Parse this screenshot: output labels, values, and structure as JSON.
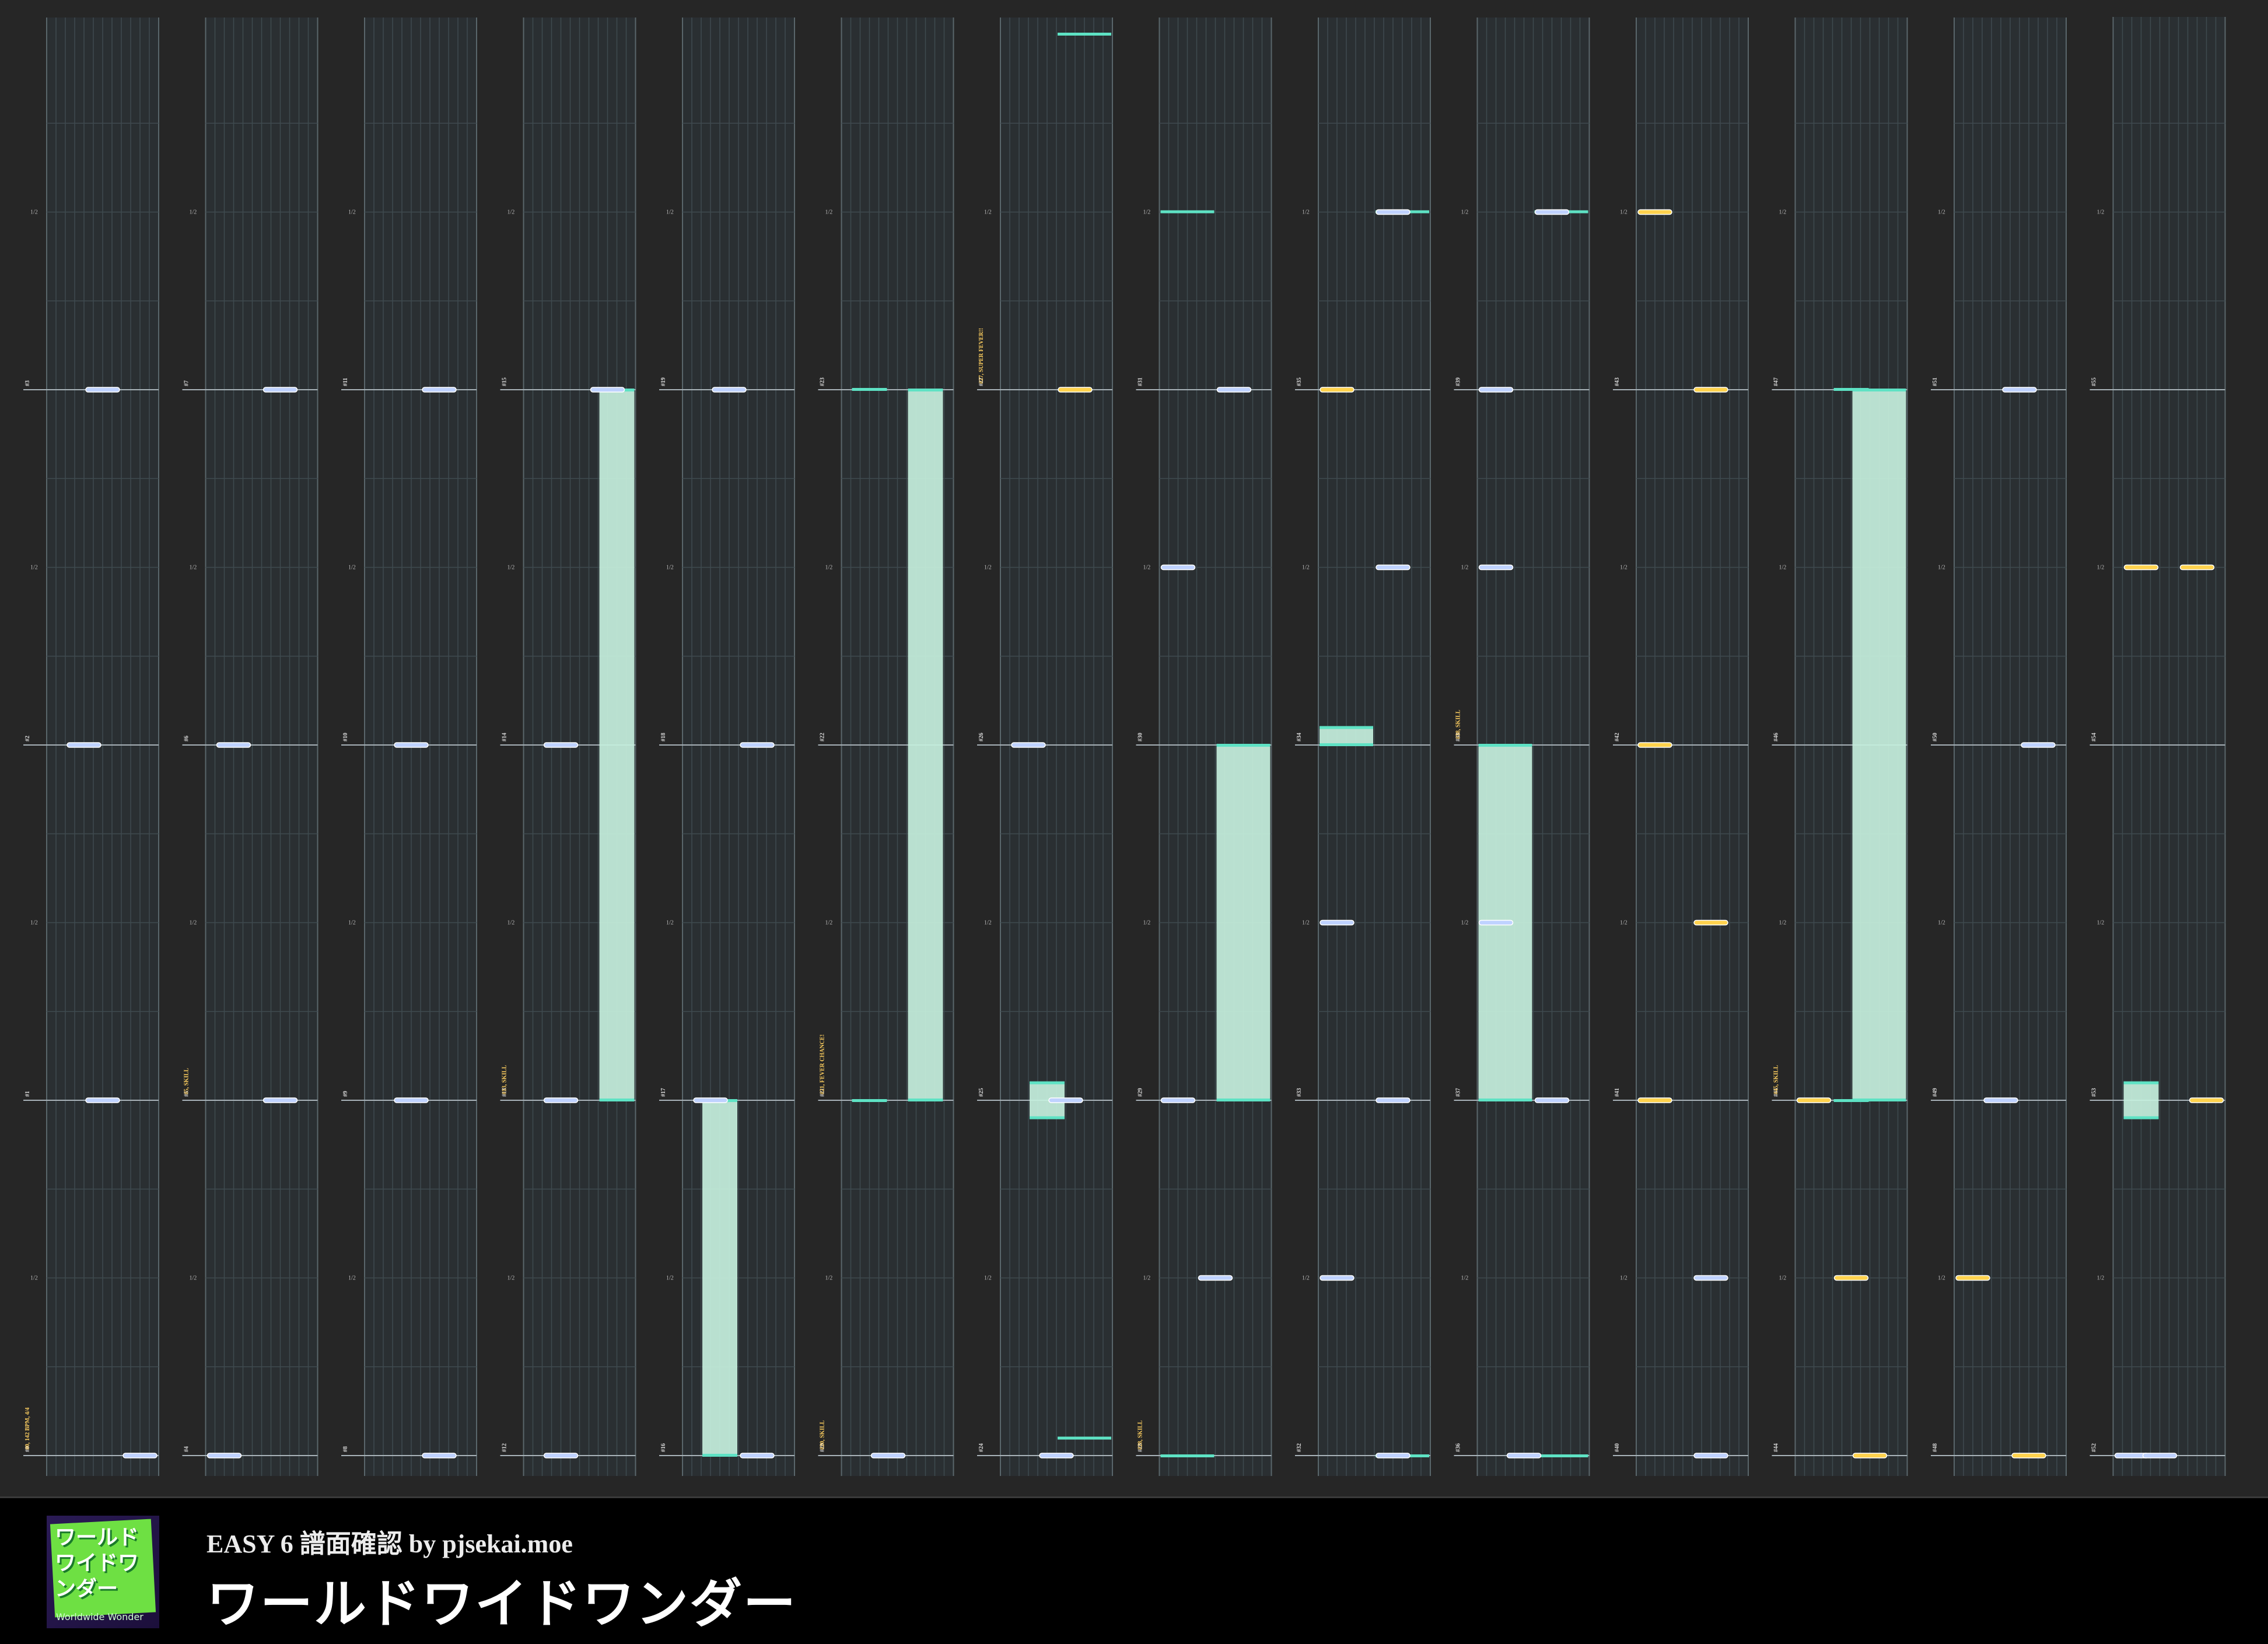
{
  "chart_data": {
    "type": "rhythm_game_chart",
    "difficulty": "EASY",
    "level": 6,
    "lanes": 12,
    "bars_per_column": 4,
    "total_bars": 56,
    "events": [
      {
        "bar": 0,
        "text": "#0, 142 BPM, 4/4"
      },
      {
        "bar": 5,
        "text": "#5, SKILL"
      },
      {
        "bar": 13,
        "text": "#13, SKILL"
      },
      {
        "bar": 20,
        "text": "#20, SKILL"
      },
      {
        "bar": 21,
        "text": "#21, FEVER CHANCE!"
      },
      {
        "bar": 27,
        "text": "#27, SUPER FEVER!!"
      },
      {
        "bar": 28,
        "text": "#28, SKILL"
      },
      {
        "bar": 38,
        "text": "#38, SKILL"
      },
      {
        "bar": 45,
        "text": "#45, SKILL"
      }
    ],
    "colors": {
      "tap": "#bfd2ff",
      "flick": "#ffd24d",
      "hold": "#c6f0dd",
      "hold_edge": "#5ee2c4"
    },
    "taps": [
      [
        0,
        0.0,
        8,
        12
      ],
      [
        1,
        0.0,
        4,
        8
      ],
      [
        2,
        0.0,
        2,
        6
      ],
      [
        3,
        0.0,
        4,
        8
      ],
      [
        4,
        0.0,
        0,
        4
      ],
      [
        5,
        0.0,
        6,
        10
      ],
      [
        6,
        0.0,
        1,
        5
      ],
      [
        7,
        0.0,
        6,
        10
      ],
      [
        8,
        0.0,
        6,
        10
      ],
      [
        9,
        0.0,
        3,
        7
      ],
      [
        10,
        0.0,
        3,
        7
      ],
      [
        11,
        0.0,
        6,
        10
      ],
      [
        12,
        0.0,
        2,
        6
      ],
      [
        13,
        0.0,
        2,
        6
      ],
      [
        14,
        0.0,
        2,
        6
      ],
      [
        15,
        0.0,
        7,
        11
      ],
      [
        16,
        0.0,
        6,
        10
      ],
      [
        17,
        0.0,
        1,
        5
      ],
      [
        18,
        0.0,
        6,
        10
      ],
      [
        19,
        0.0,
        3,
        7
      ],
      [
        20,
        0.0,
        3,
        7
      ],
      [
        24,
        0.0,
        4,
        8
      ],
      [
        25,
        0.0,
        5,
        9
      ],
      [
        26,
        0.0,
        1,
        5
      ],
      [
        28,
        0.5,
        4,
        8
      ],
      [
        29,
        0.0,
        0,
        4
      ],
      [
        30,
        0.5,
        0,
        4
      ],
      [
        31,
        0.0,
        6,
        10
      ],
      [
        32,
        0.0,
        6,
        10
      ],
      [
        32,
        0.5,
        0,
        4
      ],
      [
        33,
        0.0,
        6,
        10
      ],
      [
        33,
        0.5,
        0,
        4
      ],
      [
        34,
        0.5,
        6,
        10
      ],
      [
        35,
        0.5,
        6,
        10
      ],
      [
        36,
        0.0,
        3,
        7
      ],
      [
        37,
        0.0,
        6,
        10
      ],
      [
        37,
        0.5,
        0,
        4
      ],
      [
        38,
        0.5,
        0,
        4
      ],
      [
        39,
        0.0,
        0,
        4
      ],
      [
        39,
        0.5,
        6,
        10
      ],
      [
        40,
        0.0,
        6,
        10
      ],
      [
        40,
        0.5,
        6,
        10
      ],
      [
        49,
        0.0,
        3,
        7
      ],
      [
        50,
        0.0,
        7,
        11
      ],
      [
        51,
        0.0,
        5,
        9
      ],
      [
        52,
        0.0,
        0,
        4
      ],
      [
        52,
        0.0,
        3,
        7
      ]
    ],
    "flicks": [
      [
        27,
        0.0,
        6,
        10
      ],
      [
        35,
        0.0,
        0,
        4
      ],
      [
        41,
        0.0,
        0,
        4
      ],
      [
        41,
        0.5,
        6,
        10
      ],
      [
        42,
        0.0,
        0,
        4
      ],
      [
        43,
        0.0,
        6,
        10
      ],
      [
        43,
        0.5,
        0,
        4
      ],
      [
        44,
        0.0,
        6,
        10
      ],
      [
        44,
        0.5,
        4,
        8
      ],
      [
        45,
        0.0,
        0,
        4
      ],
      [
        48,
        0.0,
        6,
        10
      ],
      [
        48,
        0.5,
        0,
        4
      ],
      [
        53,
        0.0,
        8,
        12
      ],
      [
        54,
        0.5,
        1,
        5
      ],
      [
        54,
        0.5,
        7,
        11
      ]
    ],
    "holds": [
      [
        13,
        0.0,
        14,
        1.0,
        8,
        12
      ],
      [
        16,
        0.0,
        17,
        0.0,
        2,
        6
      ],
      [
        21,
        0.0,
        23,
        0.0,
        7,
        11
      ],
      [
        23,
        0.0,
        25,
        0.0,
        1,
        5
      ],
      [
        24,
        0.95,
        25,
        0.05,
        3,
        7
      ],
      [
        27,
        1.0,
        28,
        0.05,
        6,
        12
      ],
      [
        29,
        0.0,
        30,
        0.0,
        6,
        12
      ],
      [
        31,
        0.5,
        32,
        0.0,
        0,
        6
      ],
      [
        33,
        1.0,
        34,
        0.05,
        0,
        6
      ],
      [
        35,
        0.5,
        36,
        0.0,
        6,
        12
      ],
      [
        37,
        0.0,
        38,
        0.0,
        0,
        6
      ],
      [
        39,
        0.5,
        40,
        0.0,
        6,
        12
      ],
      [
        45,
        0.0,
        47,
        0.0,
        6,
        12
      ],
      [
        47,
        0.0,
        49,
        0.0,
        4,
        8
      ],
      [
        52,
        0.95,
        53,
        0.05,
        1,
        5
      ]
    ]
  },
  "footer": {
    "subtitle": "EASY 6 譜面確認 by pjsekai.moe",
    "title": "ワールドワイドワンダー",
    "cover_art_text": "ワールドワイドワンダー",
    "cover_art_subtext": "Worldwide Wonder"
  }
}
